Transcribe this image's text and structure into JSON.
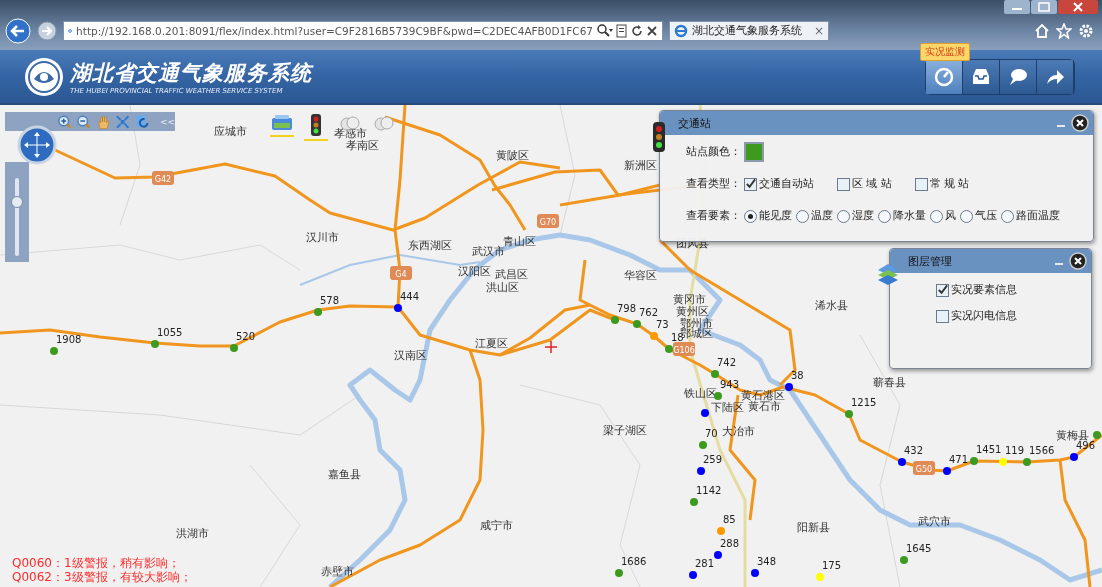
{
  "browser": {
    "url": "http://192.168.0.201:8091/flex/index.html?user=C9F2816B5739C9BF&pwd=C2DEC4AFB0D1FC67",
    "tab_title": "湖北交通气象服务系统",
    "tab_close": "×"
  },
  "header": {
    "title": "湖北省交通气象服务系统",
    "subtitle": "THE HUBEI PROVINCIAL TRAFFIC WEATHER SERVICE SYSTEM",
    "tooltip": "实况监测",
    "tools": [
      {
        "kind": "monitor",
        "selected": true
      },
      {
        "kind": "inbox",
        "selected": false
      },
      {
        "kind": "chat",
        "selected": false
      },
      {
        "kind": "share",
        "selected": false
      }
    ]
  },
  "map_toolbar": {
    "tools": [
      {
        "kind": "zoom-in"
      },
      {
        "kind": "zoom-out"
      },
      {
        "kind": "pan"
      },
      {
        "kind": "extent"
      },
      {
        "kind": "refresh"
      }
    ],
    "collapse": "<<",
    "zoom": {
      "level": 0.72
    }
  },
  "map_layers": [
    {
      "kind": "layers",
      "selected": true
    },
    {
      "kind": "traffic",
      "selected": true
    },
    {
      "kind": "cloud",
      "selected": false
    },
    {
      "kind": "cloud",
      "selected": false
    }
  ],
  "places": [
    "应城市",
    "孝感市",
    "孝南区",
    "黄陂区",
    "汉川市",
    "东西湖区",
    "武汉市",
    "青山区",
    "汉阳区",
    "武昌区",
    "洪山区",
    "华容区",
    "团风县",
    "新洲区",
    "黄冈市",
    "黄州区",
    "鄂州市",
    "鄂城区",
    "浠水县",
    "蕲春县",
    "黄石港区",
    "黄石市",
    "铁山区",
    "下陆区",
    "梁子湖区",
    "大冶市",
    "阳新县",
    "武穴市",
    "黄梅县",
    "汉南区",
    "江夏区",
    "嘉鱼县",
    "洪湖市",
    "咸宁市",
    "赤壁市"
  ],
  "road_shields": [
    "G42",
    "G70",
    "G4",
    "G106",
    "G50"
  ],
  "stations": [
    {
      "value": "1908",
      "color": "#3c9a1e"
    },
    {
      "value": "1055",
      "color": "#3c9a1e"
    },
    {
      "value": "520",
      "color": "#3c9a1e"
    },
    {
      "value": "578",
      "color": "#3c9a1e"
    },
    {
      "value": "444",
      "color": "#0000ff"
    },
    {
      "value": "798",
      "color": "#3c9a1e"
    },
    {
      "value": "762",
      "color": "#3c9a1e"
    },
    {
      "value": "73",
      "color": "#ff9900"
    },
    {
      "value": "18",
      "color": "#3c9a1e"
    },
    {
      "value": "742",
      "color": "#3c9a1e"
    },
    {
      "value": "943",
      "color": "#3c9a1e"
    },
    {
      "value": "38",
      "color": "#0000ff"
    },
    {
      "value": "1215",
      "color": "#3c9a1e"
    },
    {
      "color": "#0000ff"
    },
    {
      "value": "70",
      "color": "#3c9a1e"
    },
    {
      "value": "259",
      "color": "#0000ff"
    },
    {
      "value": "1142",
      "color": "#3c9a1e"
    },
    {
      "value": "85",
      "color": "#ff9900"
    },
    {
      "value": "288",
      "color": "#0000ff"
    },
    {
      "value": "281",
      "color": "#0000ff"
    },
    {
      "value": "348",
      "color": "#0000ff"
    },
    {
      "value": "175",
      "color": "#ffff00"
    },
    {
      "value": "1686",
      "color": "#3c9a1e"
    },
    {
      "value": "1645",
      "color": "#3c9a1e"
    },
    {
      "value": "432",
      "color": "#0000ff"
    },
    {
      "value": "471",
      "color": "#0000ff"
    },
    {
      "value": "1451",
      "color": "#3c9a1e"
    },
    {
      "value": "119",
      "color": "#ffff00"
    },
    {
      "value": "1566",
      "color": "#3c9a1e"
    },
    {
      "value": "496",
      "color": "#0000ff"
    },
    {
      "color": "#3c9a1e"
    }
  ],
  "alerts": [
    "Q0060：1级警报，稍有影响；",
    "Q0062：3级警报，有较大影响；"
  ],
  "station_panel": {
    "title": "交通站",
    "color_label": "站点颜色：",
    "color": "#3c9a1e",
    "type_label": "查看类型：",
    "types": [
      {
        "label": "交通自动站",
        "checked": true
      },
      {
        "label": "区 域 站",
        "checked": false
      },
      {
        "label": "常 规 站",
        "checked": false
      }
    ],
    "element_label": "查看要素：",
    "elements": [
      {
        "label": "能见度",
        "selected": true
      },
      {
        "label": "温度",
        "selected": false
      },
      {
        "label": "湿度",
        "selected": false
      },
      {
        "label": "降水量",
        "selected": false
      },
      {
        "label": "风",
        "selected": false
      },
      {
        "label": "气压",
        "selected": false
      },
      {
        "label": "路面温度",
        "selected": false
      }
    ]
  },
  "layer_panel": {
    "title": "图层管理",
    "layers": [
      {
        "label": "实况要素信息",
        "checked": true
      },
      {
        "label": "实况闪电信息",
        "checked": false
      }
    ]
  }
}
